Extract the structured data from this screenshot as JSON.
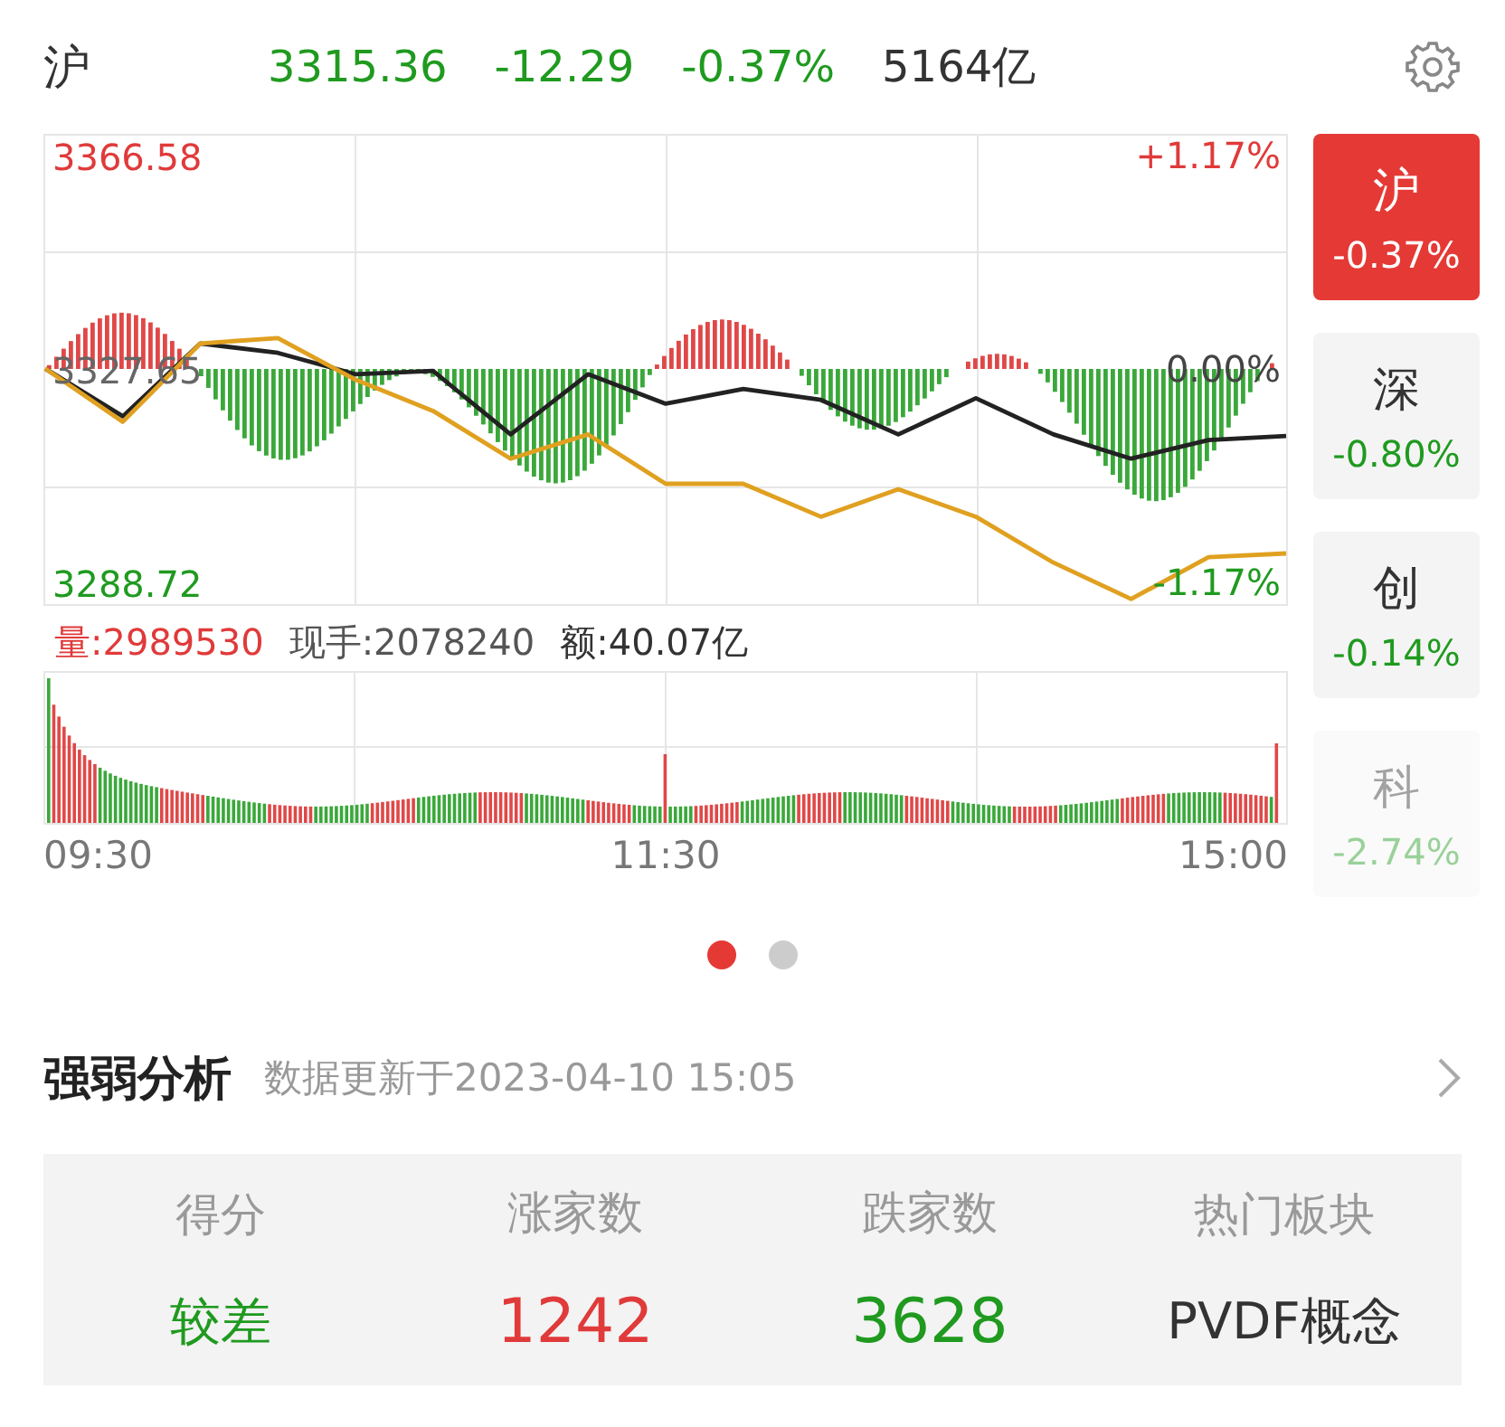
{
  "header": {
    "market": "沪",
    "price": "3315.36",
    "change": "-12.29",
    "change_pct": "-0.37%",
    "turnover": "5164亿",
    "color": "#1f9a1f"
  },
  "chart": {
    "chart_data": {
      "type": "line",
      "series": [
        {
          "color": "#222222",
          "values": [
            3327.7,
            3319,
            3332.3,
            3330.6,
            3326.7,
            3327.3,
            3315.7,
            3326.7,
            3321.3,
            3324,
            3322,
            3315.7,
            3322.3,
            3315.7,
            3311.3,
            3314.7,
            3315.4
          ]
        },
        {
          "color": "#e0a020",
          "values": [
            3327.7,
            3318,
            3332.3,
            3333.3,
            3325.7,
            3320,
            3311.3,
            3315.7,
            3306.7,
            3306.7,
            3300.7,
            3305.7,
            3300.7,
            3292.3,
            3285.7,
            3293.3,
            3294
          ]
        }
      ],
      "ylim": [
        3284.76,
        3370.54
      ],
      "yticks": [
        {
          "value": 3366.58,
          "label": "3366.58"
        },
        {
          "value": 3327.65,
          "label": "3327.65"
        },
        {
          "value": 3288.72,
          "label": "3288.72"
        }
      ]
    },
    "time_labels": [
      "09:30",
      "11:30",
      "15:00"
    ],
    "percent_labels": [
      {
        "text": "+1.17%",
        "color": "#e03a3a"
      },
      {
        "text": "0.00%",
        "color": "#444444"
      },
      {
        "text": "-1.17%",
        "color": "#1f9a1f"
      }
    ]
  },
  "volume": {
    "label": "量:2989530",
    "hand_label": "现手:2078240",
    "amount_label": "额:40.07亿"
  },
  "index_tabs": [
    {
      "name": "沪",
      "change": "-0.37%",
      "selected": true,
      "dimmed": false
    },
    {
      "name": "深",
      "change": "-0.80%",
      "selected": false,
      "dimmed": false
    },
    {
      "name": "创",
      "change": "-0.14%",
      "selected": false,
      "dimmed": false
    },
    {
      "name": "科",
      "change": "-2.74%",
      "selected": false,
      "dimmed": true
    }
  ],
  "page_dots": [
    {
      "selected": true
    },
    {
      "selected": false
    }
  ],
  "analysis": {
    "title": "强弱分析",
    "updated": "数据更新于2023-04-10 15:05",
    "columns": [
      {
        "heading": "得分",
        "value": "较差",
        "color": "#1f9a1f"
      },
      {
        "heading": "涨家数",
        "value": "1242",
        "color": "#e03a3a"
      },
      {
        "heading": "跌家数",
        "value": "3628",
        "color": "#1f9a1f"
      },
      {
        "heading": "热门板块",
        "value": "PVDF概念",
        "color": "#333333"
      }
    ]
  }
}
